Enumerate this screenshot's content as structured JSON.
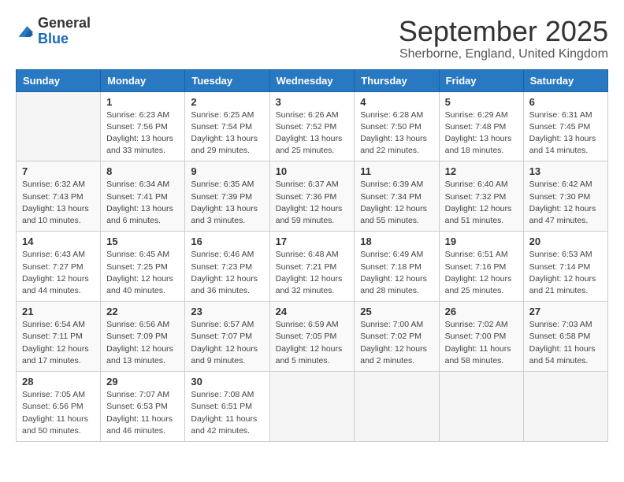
{
  "logo": {
    "general": "General",
    "blue": "Blue"
  },
  "title": "September 2025",
  "location": "Sherborne, England, United Kingdom",
  "days_of_week": [
    "Sunday",
    "Monday",
    "Tuesday",
    "Wednesday",
    "Thursday",
    "Friday",
    "Saturday"
  ],
  "weeks": [
    [
      {
        "date": "",
        "sunrise": "",
        "sunset": "",
        "daylight": ""
      },
      {
        "date": "1",
        "sunrise": "Sunrise: 6:23 AM",
        "sunset": "Sunset: 7:56 PM",
        "daylight": "Daylight: 13 hours and 33 minutes."
      },
      {
        "date": "2",
        "sunrise": "Sunrise: 6:25 AM",
        "sunset": "Sunset: 7:54 PM",
        "daylight": "Daylight: 13 hours and 29 minutes."
      },
      {
        "date": "3",
        "sunrise": "Sunrise: 6:26 AM",
        "sunset": "Sunset: 7:52 PM",
        "daylight": "Daylight: 13 hours and 25 minutes."
      },
      {
        "date": "4",
        "sunrise": "Sunrise: 6:28 AM",
        "sunset": "Sunset: 7:50 PM",
        "daylight": "Daylight: 13 hours and 22 minutes."
      },
      {
        "date": "5",
        "sunrise": "Sunrise: 6:29 AM",
        "sunset": "Sunset: 7:48 PM",
        "daylight": "Daylight: 13 hours and 18 minutes."
      },
      {
        "date": "6",
        "sunrise": "Sunrise: 6:31 AM",
        "sunset": "Sunset: 7:45 PM",
        "daylight": "Daylight: 13 hours and 14 minutes."
      }
    ],
    [
      {
        "date": "7",
        "sunrise": "Sunrise: 6:32 AM",
        "sunset": "Sunset: 7:43 PM",
        "daylight": "Daylight: 13 hours and 10 minutes."
      },
      {
        "date": "8",
        "sunrise": "Sunrise: 6:34 AM",
        "sunset": "Sunset: 7:41 PM",
        "daylight": "Daylight: 13 hours and 6 minutes."
      },
      {
        "date": "9",
        "sunrise": "Sunrise: 6:35 AM",
        "sunset": "Sunset: 7:39 PM",
        "daylight": "Daylight: 13 hours and 3 minutes."
      },
      {
        "date": "10",
        "sunrise": "Sunrise: 6:37 AM",
        "sunset": "Sunset: 7:36 PM",
        "daylight": "Daylight: 12 hours and 59 minutes."
      },
      {
        "date": "11",
        "sunrise": "Sunrise: 6:39 AM",
        "sunset": "Sunset: 7:34 PM",
        "daylight": "Daylight: 12 hours and 55 minutes."
      },
      {
        "date": "12",
        "sunrise": "Sunrise: 6:40 AM",
        "sunset": "Sunset: 7:32 PM",
        "daylight": "Daylight: 12 hours and 51 minutes."
      },
      {
        "date": "13",
        "sunrise": "Sunrise: 6:42 AM",
        "sunset": "Sunset: 7:30 PM",
        "daylight": "Daylight: 12 hours and 47 minutes."
      }
    ],
    [
      {
        "date": "14",
        "sunrise": "Sunrise: 6:43 AM",
        "sunset": "Sunset: 7:27 PM",
        "daylight": "Daylight: 12 hours and 44 minutes."
      },
      {
        "date": "15",
        "sunrise": "Sunrise: 6:45 AM",
        "sunset": "Sunset: 7:25 PM",
        "daylight": "Daylight: 12 hours and 40 minutes."
      },
      {
        "date": "16",
        "sunrise": "Sunrise: 6:46 AM",
        "sunset": "Sunset: 7:23 PM",
        "daylight": "Daylight: 12 hours and 36 minutes."
      },
      {
        "date": "17",
        "sunrise": "Sunrise: 6:48 AM",
        "sunset": "Sunset: 7:21 PM",
        "daylight": "Daylight: 12 hours and 32 minutes."
      },
      {
        "date": "18",
        "sunrise": "Sunrise: 6:49 AM",
        "sunset": "Sunset: 7:18 PM",
        "daylight": "Daylight: 12 hours and 28 minutes."
      },
      {
        "date": "19",
        "sunrise": "Sunrise: 6:51 AM",
        "sunset": "Sunset: 7:16 PM",
        "daylight": "Daylight: 12 hours and 25 minutes."
      },
      {
        "date": "20",
        "sunrise": "Sunrise: 6:53 AM",
        "sunset": "Sunset: 7:14 PM",
        "daylight": "Daylight: 12 hours and 21 minutes."
      }
    ],
    [
      {
        "date": "21",
        "sunrise": "Sunrise: 6:54 AM",
        "sunset": "Sunset: 7:11 PM",
        "daylight": "Daylight: 12 hours and 17 minutes."
      },
      {
        "date": "22",
        "sunrise": "Sunrise: 6:56 AM",
        "sunset": "Sunset: 7:09 PM",
        "daylight": "Daylight: 12 hours and 13 minutes."
      },
      {
        "date": "23",
        "sunrise": "Sunrise: 6:57 AM",
        "sunset": "Sunset: 7:07 PM",
        "daylight": "Daylight: 12 hours and 9 minutes."
      },
      {
        "date": "24",
        "sunrise": "Sunrise: 6:59 AM",
        "sunset": "Sunset: 7:05 PM",
        "daylight": "Daylight: 12 hours and 5 minutes."
      },
      {
        "date": "25",
        "sunrise": "Sunrise: 7:00 AM",
        "sunset": "Sunset: 7:02 PM",
        "daylight": "Daylight: 12 hours and 2 minutes."
      },
      {
        "date": "26",
        "sunrise": "Sunrise: 7:02 AM",
        "sunset": "Sunset: 7:00 PM",
        "daylight": "Daylight: 11 hours and 58 minutes."
      },
      {
        "date": "27",
        "sunrise": "Sunrise: 7:03 AM",
        "sunset": "Sunset: 6:58 PM",
        "daylight": "Daylight: 11 hours and 54 minutes."
      }
    ],
    [
      {
        "date": "28",
        "sunrise": "Sunrise: 7:05 AM",
        "sunset": "Sunset: 6:56 PM",
        "daylight": "Daylight: 11 hours and 50 minutes."
      },
      {
        "date": "29",
        "sunrise": "Sunrise: 7:07 AM",
        "sunset": "Sunset: 6:53 PM",
        "daylight": "Daylight: 11 hours and 46 minutes."
      },
      {
        "date": "30",
        "sunrise": "Sunrise: 7:08 AM",
        "sunset": "Sunset: 6:51 PM",
        "daylight": "Daylight: 11 hours and 42 minutes."
      },
      {
        "date": "",
        "sunrise": "",
        "sunset": "",
        "daylight": ""
      },
      {
        "date": "",
        "sunrise": "",
        "sunset": "",
        "daylight": ""
      },
      {
        "date": "",
        "sunrise": "",
        "sunset": "",
        "daylight": ""
      },
      {
        "date": "",
        "sunrise": "",
        "sunset": "",
        "daylight": ""
      }
    ]
  ]
}
